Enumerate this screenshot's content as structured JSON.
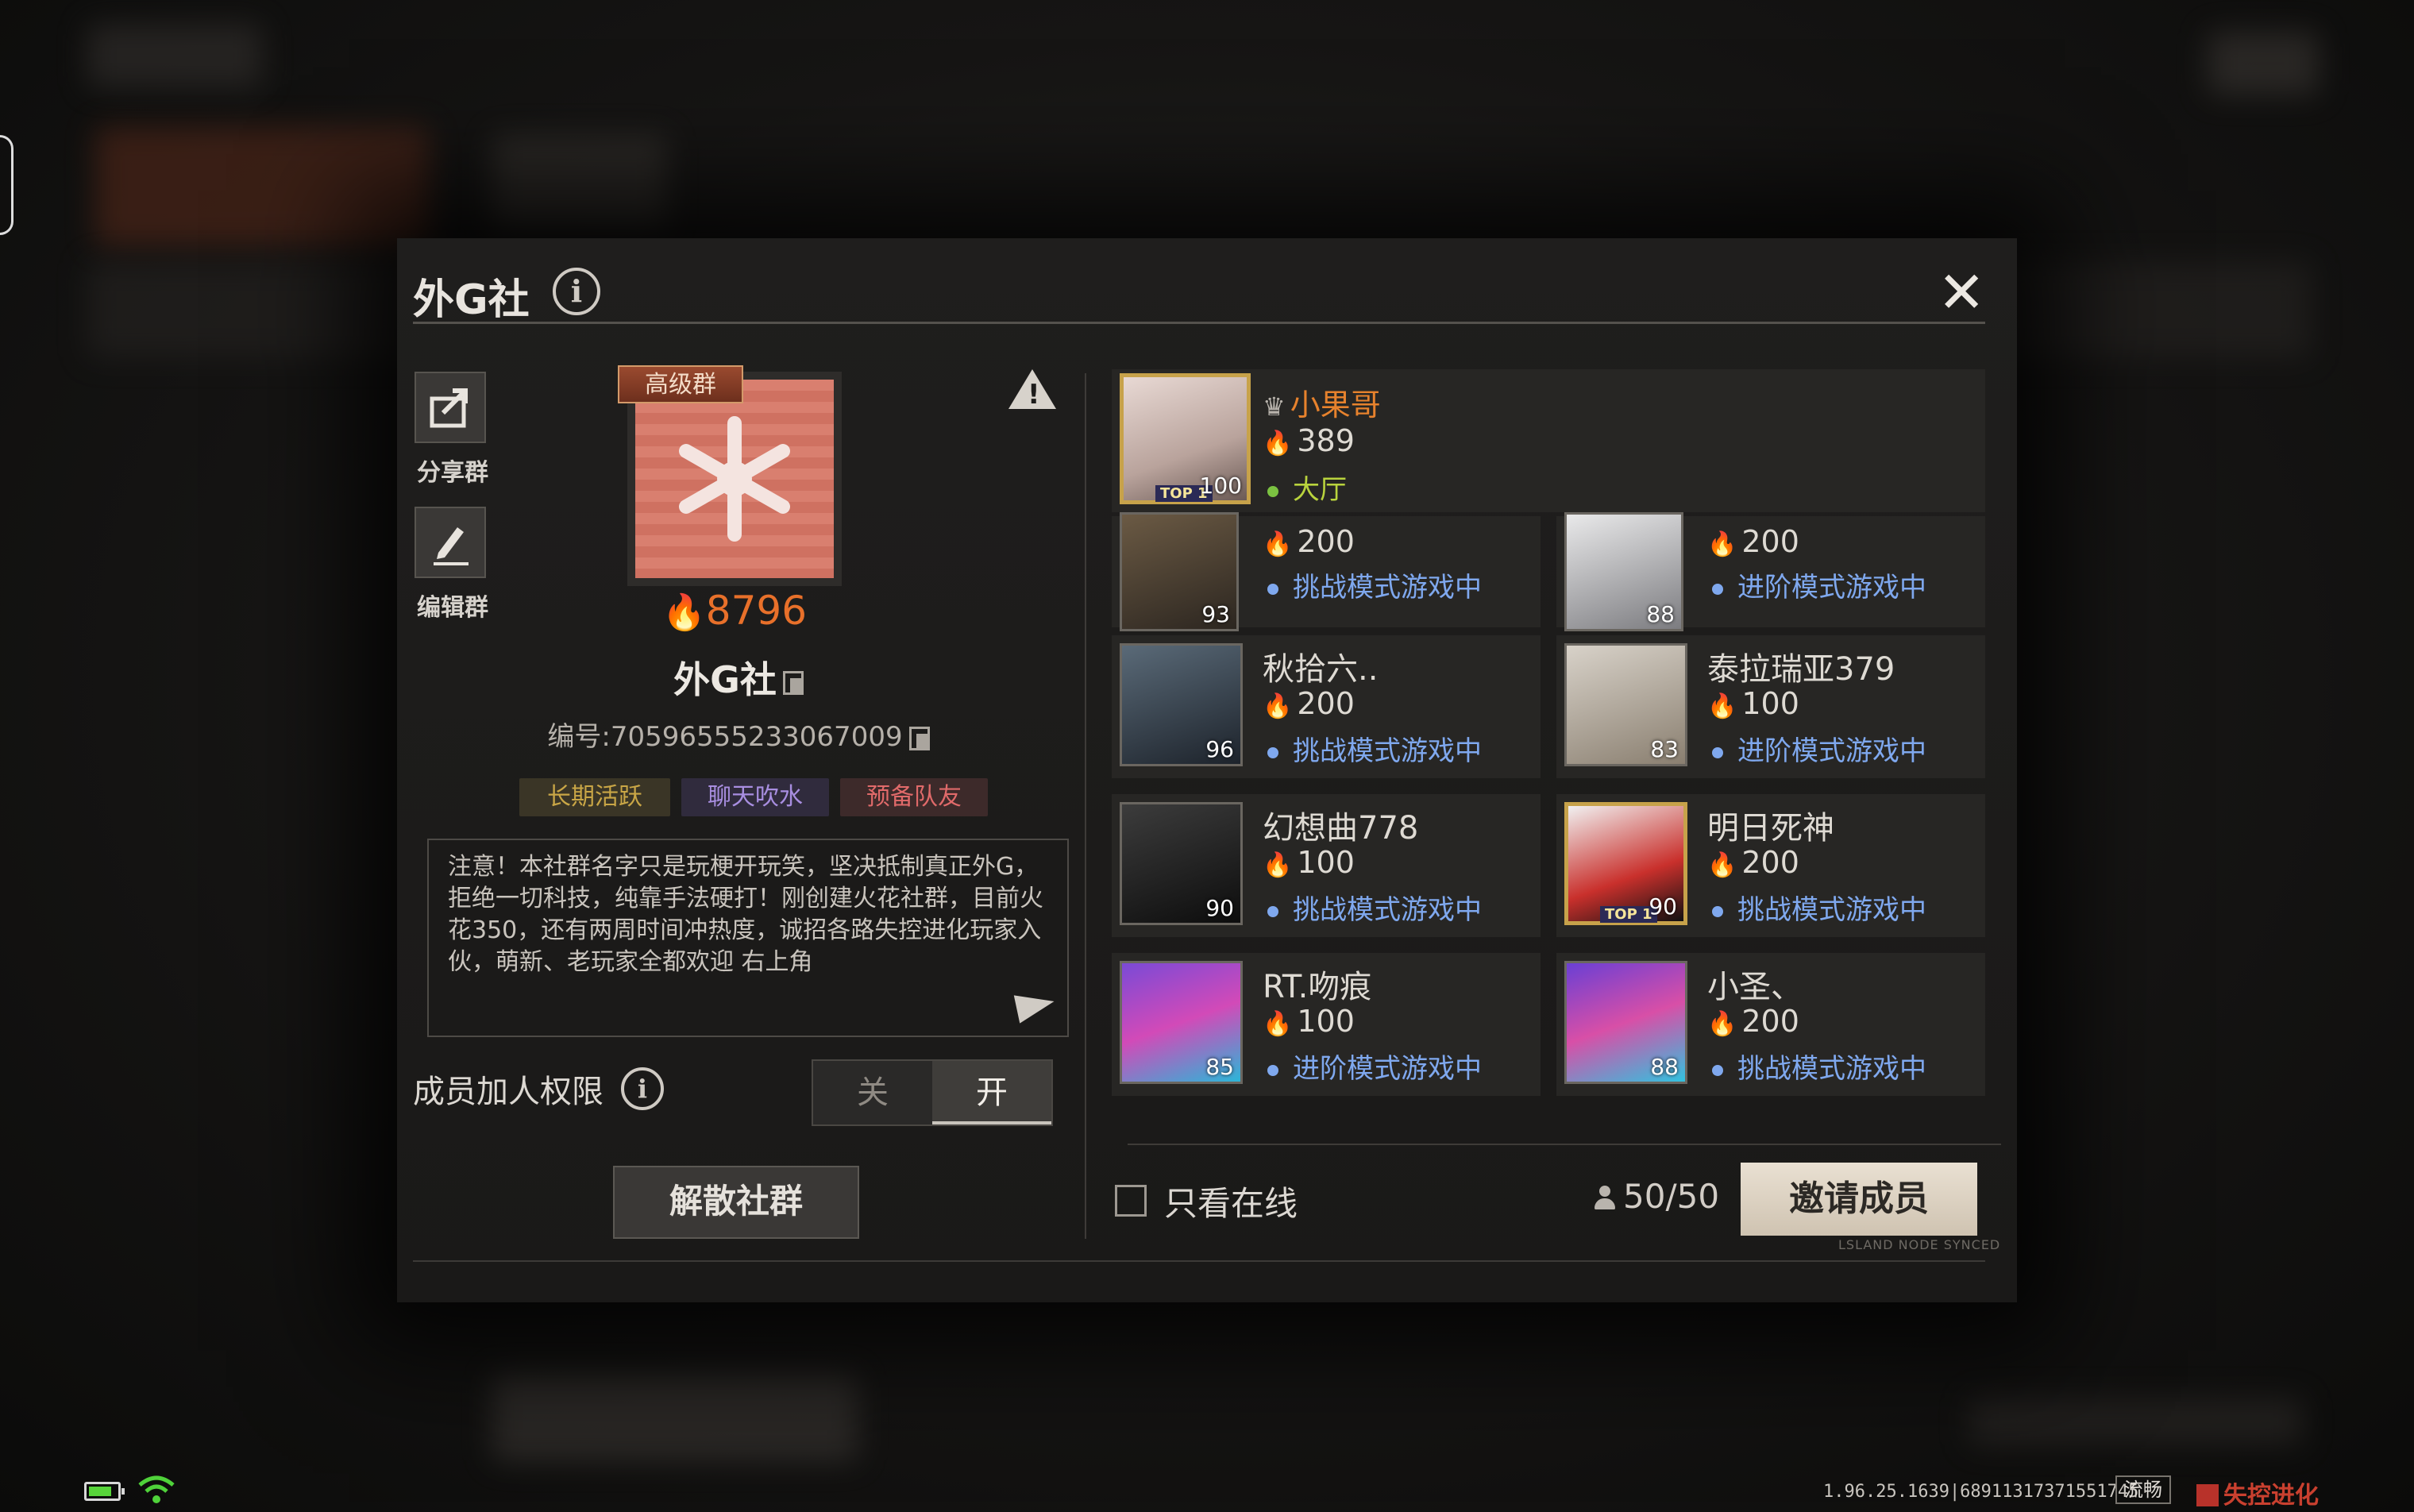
{
  "dialog": {
    "title": "外G社",
    "close": "✕"
  },
  "sidebar": {
    "share_label": "分享群",
    "edit_label": "编辑群"
  },
  "group": {
    "badge": "高级群",
    "heat": "8796",
    "name": "外G社",
    "id_text": "编号:70596555233067009",
    "tags": [
      {
        "label": "长期活跃",
        "color": "#c9a646",
        "bg": "#3a3526"
      },
      {
        "label": "聊天吹水",
        "color": "#a88ee0",
        "bg": "#302b3d"
      },
      {
        "label": "预备队友",
        "color": "#e06a6a",
        "bg": "#3d2a2a"
      }
    ],
    "notice": "注意！本社群名字只是玩梗开玩笑，坚决抵制真正外G，拒绝一切科技，纯靠手法硬打！刚创建火花社群，目前火花350，还有两周时间冲热度，诚招各路失控进化玩家入伙，萌新、老玩家全都欢迎 右上角"
  },
  "permission": {
    "label": "成员加人权限",
    "off": "关",
    "on": "开",
    "value": "开"
  },
  "disband_label": "解散社群",
  "owner": {
    "name": "小果哥",
    "heat": "389",
    "level": "100",
    "status": "大厅",
    "frame_tag": "TOP 1"
  },
  "members": [
    {
      "name": "",
      "heat": "200",
      "level": "93",
      "status": "挑战模式游戏中"
    },
    {
      "name": "",
      "heat": "200",
      "level": "88",
      "status": "进阶模式游戏中"
    },
    {
      "name": "秋拾六..",
      "heat": "200",
      "level": "96",
      "status": "挑战模式游戏中"
    },
    {
      "name": "泰拉瑞亚379",
      "heat": "100",
      "level": "83",
      "status": "进阶模式游戏中"
    },
    {
      "name": "幻想曲778",
      "heat": "100",
      "level": "90",
      "status": "挑战模式游戏中"
    },
    {
      "name": "明日死神",
      "heat": "200",
      "level": "90",
      "status": "挑战模式游戏中",
      "frame_tag": "TOP 1"
    },
    {
      "name": "RT.吻痕",
      "heat": "100",
      "level": "85",
      "status": "进阶模式游戏中"
    },
    {
      "name": "小圣、",
      "heat": "200",
      "level": "88",
      "status": "挑战模式游戏中"
    }
  ],
  "footer": {
    "online_only_label": "只看在线",
    "member_count": "50/50",
    "invite_label": "邀请成员",
    "synced_text": "LSLAND NODE SYNCED"
  },
  "statusbar": {
    "version": "1.96.25.1639|68911317371551745",
    "network": "流畅",
    "logo": "失控进化"
  },
  "colors": {
    "accent_orange": "#e8702a",
    "status_blue": "#7fa8ee",
    "lobby_green": "#b9d33d"
  }
}
